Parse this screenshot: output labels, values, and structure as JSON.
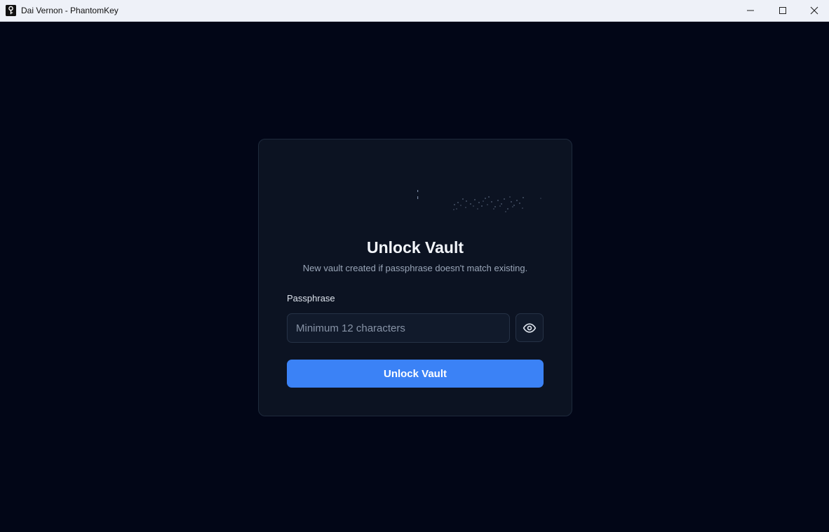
{
  "window": {
    "title": "Dai Vernon - PhantomKey",
    "controls": {
      "minimize_icon": "minimize-icon",
      "maximize_icon": "maximize-icon",
      "close_icon": "close-icon"
    }
  },
  "unlock": {
    "title": "Unlock Vault",
    "subtitle": "New vault created if passphrase doesn't match existing.",
    "passphrase_label": "Passphrase",
    "passphrase_value": "",
    "passphrase_placeholder": "Minimum 12 characters",
    "reveal_icon": "eye-icon",
    "submit_label": "Unlock Vault"
  },
  "colors": {
    "background": "#020617",
    "card": "#0c1322",
    "accent": "#3b82f6",
    "title_text": "#f3f6fb",
    "muted_text": "#9aa6b8"
  }
}
